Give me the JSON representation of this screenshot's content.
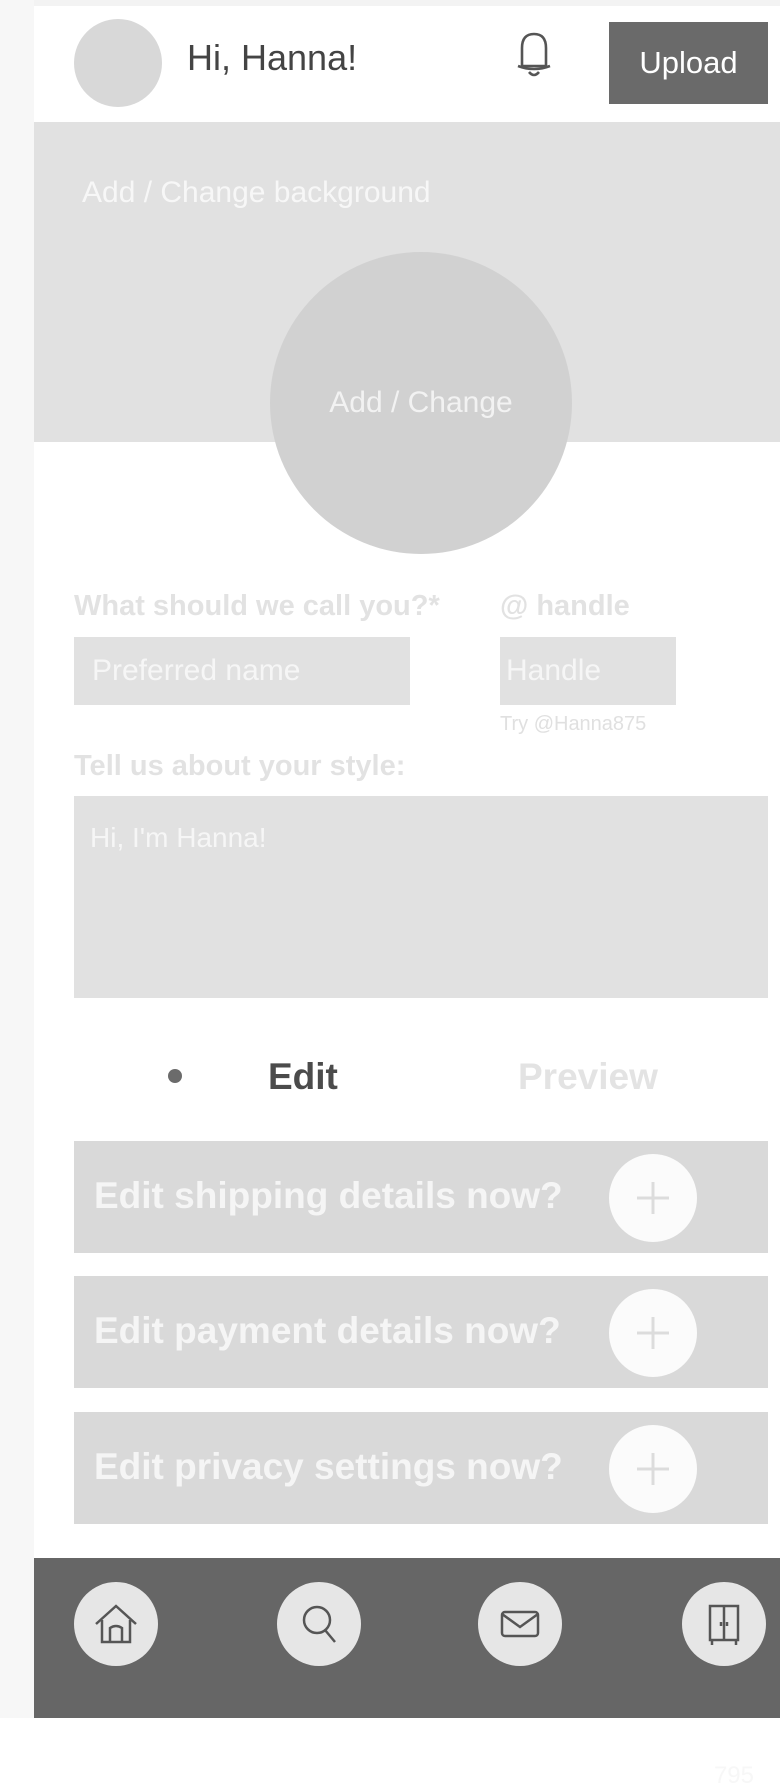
{
  "header": {
    "greeting": "Hi, Hanna!",
    "upload_label": "Upload",
    "bell_icon": "bell-icon"
  },
  "banner": {
    "background_label": "Add / Change background",
    "photo_label": "Add / Change"
  },
  "form": {
    "name_label": "What should we call you?*",
    "name_placeholder": "Preferred name",
    "handle_label": "@ handle",
    "handle_placeholder": "Handle",
    "handle_hint": "Try @Hanna875",
    "bio_label": "Tell us about your style:",
    "bio_value": "Hi, I'm Hanna!",
    "bio_counter": "795"
  },
  "tabs": {
    "edit": "Edit",
    "preview": "Preview"
  },
  "actions": [
    {
      "label": "Edit shipping details now?",
      "icon": "plus-icon"
    },
    {
      "label": "Edit payment details now?",
      "icon": "plus-icon"
    },
    {
      "label": "Edit privacy settings now?",
      "icon": "plus-icon"
    }
  ],
  "nav": {
    "items": [
      {
        "icon": "home-icon"
      },
      {
        "icon": "search-icon"
      },
      {
        "icon": "mail-icon"
      },
      {
        "icon": "wardrobe-icon"
      }
    ]
  },
  "colors": {
    "nav_bg": "#666666",
    "upload_bg": "#6a6a6a",
    "placeholder_gray": "#e1e1e1"
  }
}
